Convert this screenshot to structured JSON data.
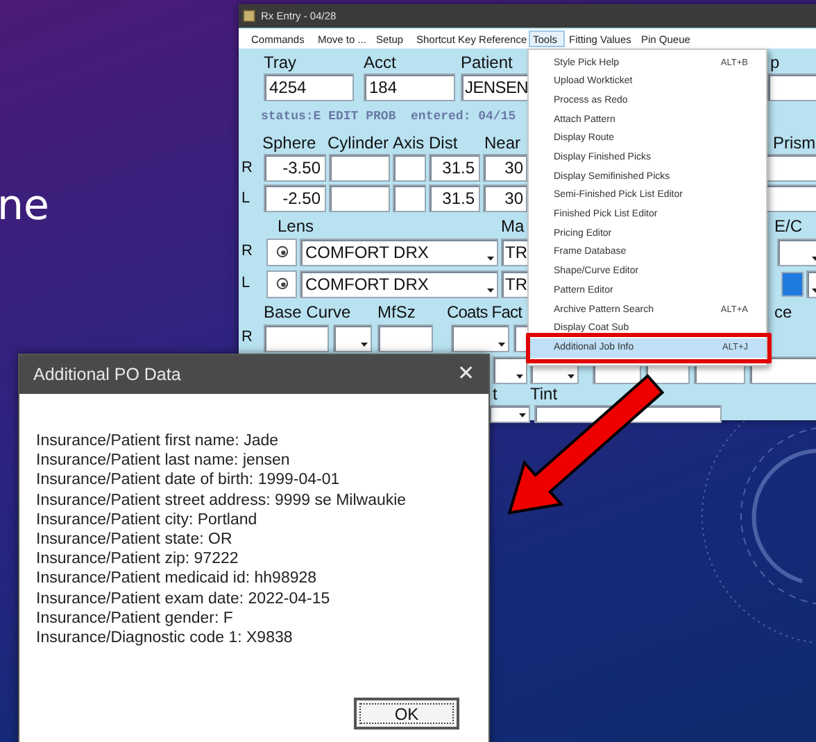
{
  "slide": {
    "title_fragment": "ne"
  },
  "rx_window": {
    "title": "Rx Entry - 04/28",
    "menu": [
      {
        "label": "Commands",
        "selected": false
      },
      {
        "label": "Move to ...",
        "selected": false
      },
      {
        "label": "Setup",
        "selected": false
      },
      {
        "label": "Shortcut Key Reference",
        "selected": false
      },
      {
        "label": "Tools",
        "selected": true
      },
      {
        "label": "Fitting Values",
        "selected": false
      },
      {
        "label": "Pin Queue",
        "selected": false
      }
    ],
    "tools_menu": [
      {
        "label": "Style Pick Help",
        "shortcut": "ALT+B",
        "selected": false
      },
      {
        "label": "Upload Workticket",
        "selected": false
      },
      {
        "label": "Process as Redo",
        "selected": false
      },
      {
        "label": "Attach Pattern",
        "selected": false
      },
      {
        "label": "Display Route",
        "selected": false
      },
      {
        "label": "Display Finished Picks",
        "selected": false
      },
      {
        "label": "Display Semifinished Picks",
        "selected": false
      },
      {
        "label": "Semi-Finished Pick List Editor",
        "selected": false
      },
      {
        "label": "Finished Pick List Editor",
        "selected": false
      },
      {
        "label": "Pricing Editor",
        "selected": false
      },
      {
        "label": "Frame Database",
        "selected": false
      },
      {
        "label": "Shape/Curve Editor",
        "selected": false
      },
      {
        "label": "Pattern Editor",
        "selected": false
      },
      {
        "label": "Archive Pattern Search",
        "shortcut": "ALT+A",
        "selected": false
      },
      {
        "label": "Display Coat Sub",
        "selected": false
      },
      {
        "label": "Additional Job Info",
        "shortcut": "ALT+J",
        "selected": true
      }
    ],
    "form": {
      "header_labels": [
        "Tray",
        "Acct",
        "Patient",
        "p"
      ],
      "header_values": [
        "4254",
        "184",
        "JENSEN"
      ],
      "status": "status:E EDIT PROB  entered: 04/15",
      "rx_labels": [
        "Sphere",
        "Cylinder",
        "Axis",
        "Dist",
        "Near",
        "Prism"
      ],
      "rx_rows": [
        {
          "eye": "R",
          "sphere": "-3.50",
          "dist": "31.5",
          "near": "30"
        },
        {
          "eye": "L",
          "sphere": "-2.50",
          "dist": "31.5",
          "near": "30"
        }
      ],
      "lens_labels": [
        "Lens",
        "Ma",
        "E/C"
      ],
      "lens_rows": [
        {
          "eye": "R",
          "lens": "COMFORT DRX",
          "material": "TR"
        },
        {
          "eye": "L",
          "lens": "COMFORT DRX",
          "material": "TR",
          "color": "#1e7be0"
        }
      ],
      "base_labels": [
        "Base Curve",
        "MfSz",
        "Coats Fact",
        "ce"
      ],
      "base_rows": [
        {
          "eye": "R"
        }
      ],
      "tint_labels": [
        "t",
        "Tint"
      ]
    }
  },
  "dialog": {
    "title": "Additional PO Data",
    "close": "✕",
    "lines": [
      "Insurance/Patient first name: Jade",
      "Insurance/Patient last name: jensen",
      "Insurance/Patient date of birth: 1999-04-01",
      "Insurance/Patient street address: 9999 se Milwaukie",
      "Insurance/Patient city: Portland",
      "Insurance/Patient state: OR",
      "Insurance/Patient zip: 97222",
      "Insurance/Patient medicaid id: hh98928",
      "Insurance/Patient exam date: 2022-04-15",
      "Insurance/Patient gender: F",
      "Insurance/Diagnostic code 1: X9838"
    ],
    "ok": "OK"
  }
}
